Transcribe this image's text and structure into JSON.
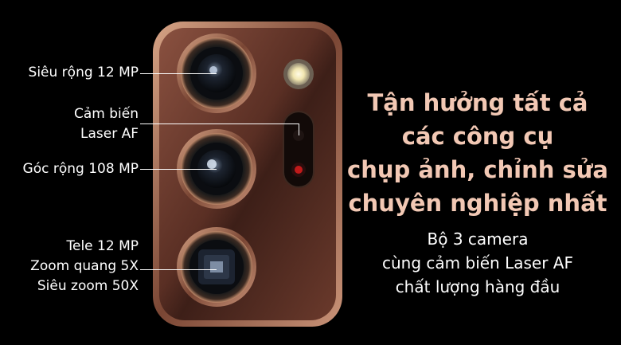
{
  "labels": {
    "ultrawide": "Siêu rộng 12 MP",
    "laser_line1": "Cảm biến",
    "laser_line2": "Laser AF",
    "wide": "Góc rộng 108 MP",
    "tele_line1": "Tele 12 MP",
    "tele_line2": "Zoom quang 5X",
    "tele_line3": "Siêu zoom 50X"
  },
  "headline": {
    "lines": [
      "Tận hưởng tất cả",
      "các công cụ",
      "chụp ảnh, chỉnh sửa",
      "chuyên nghiệp nhất"
    ],
    "color": "#f2c8b4"
  },
  "subtext": {
    "lines": [
      "Bộ 3 camera",
      "cùng cảm biến Laser AF",
      "chất lượng hàng đầu"
    ]
  },
  "colors": {
    "background": "#000000",
    "bronze_body": "#6b3a2c",
    "bronze_rim": "#b07a5a",
    "text": "#ffffff"
  }
}
